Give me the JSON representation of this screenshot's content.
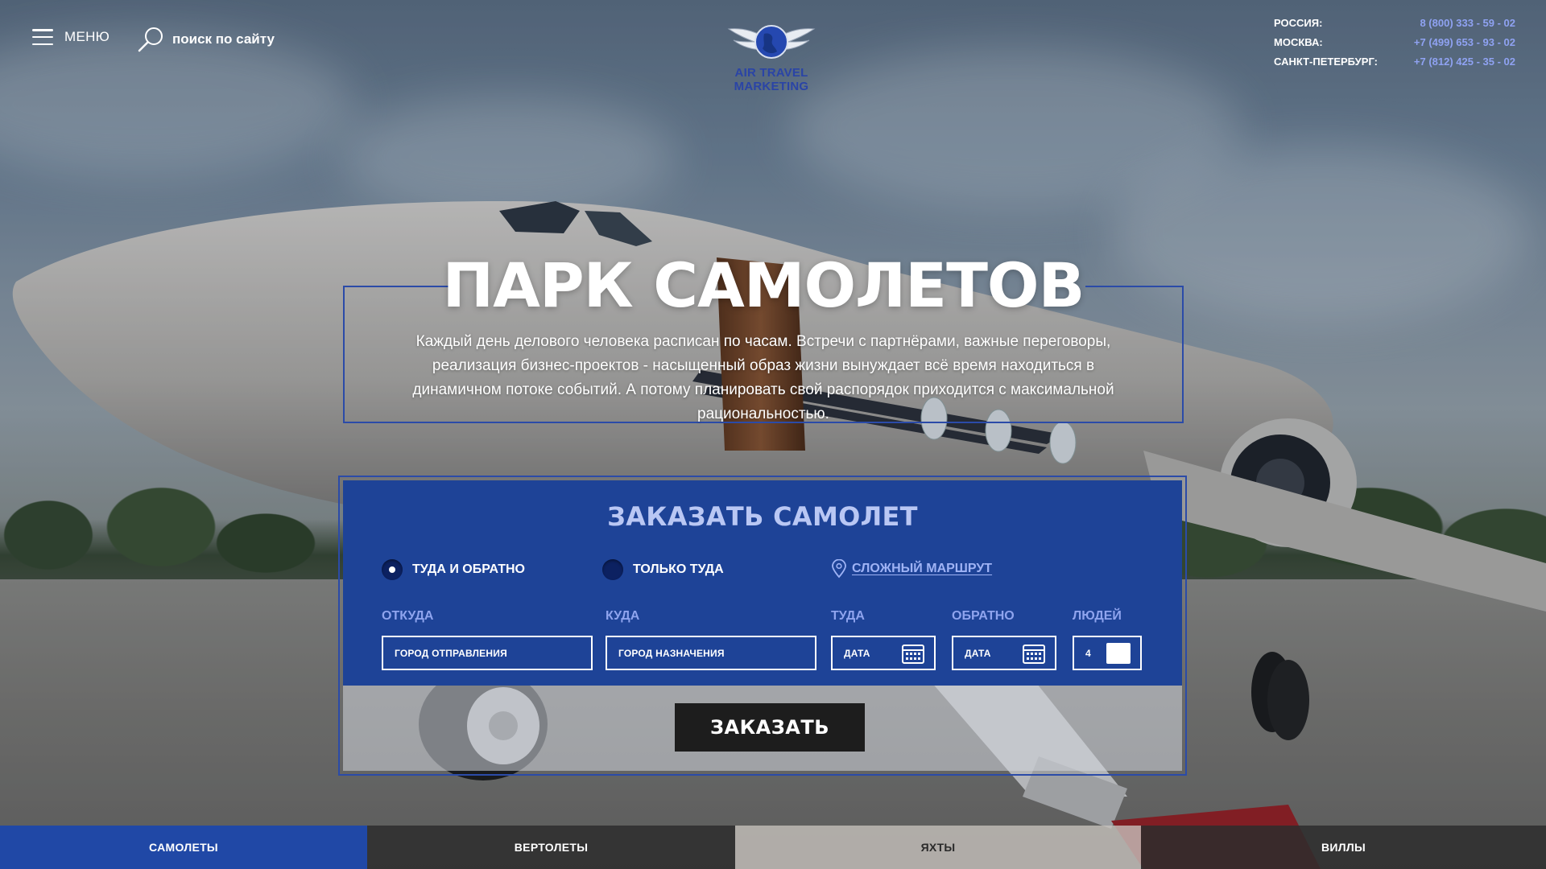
{
  "header": {
    "menu_label": "МЕНЮ",
    "search_label": "поиск по сайту",
    "logo_text": "AIR TRAVEL MARKETING",
    "phones": [
      {
        "city": "РОССИЯ:",
        "number": "8 (800) 333 - 59 - 02"
      },
      {
        "city": "МОСКВА:",
        "number": "+7 (499) 653 - 93 - 02"
      },
      {
        "city": "САНКТ-ПЕТЕРБУРГ:",
        "number": "+7 (812) 425 - 35 - 02"
      }
    ]
  },
  "hero": {
    "title": "ПАРК САМОЛЕТОВ",
    "text": "Каждый день делового человека расписан по часам. Встречи с партнёрами, важные переговоры, реализация бизнес-проектов - насыщенный образ жизни вынуждает всё время находиться в динамичном потоке событий. А потому планировать свой распорядок приходится с максимальной рациональностью."
  },
  "booking": {
    "title": "ЗАКАЗАТЬ САМОЛЕТ",
    "trip_types": [
      {
        "label": "ТУДА И ОБРАТНО",
        "selected": true
      },
      {
        "label": "ТОЛЬКО ТУДА",
        "selected": false
      }
    ],
    "complex_route_label": "СЛОЖНЫЙ МАРШРУТ",
    "fields": {
      "from": {
        "label": "ОТКУДА",
        "placeholder": "ГОРОД ОТПРАВЛЕНИЯ"
      },
      "to": {
        "label": "КУДА",
        "placeholder": "ГОРОД НАЗНАЧЕНИЯ"
      },
      "depart": {
        "label": "ТУДА",
        "placeholder": "ДАТА"
      },
      "return": {
        "label": "ОБРАТНО",
        "placeholder": "ДАТА"
      },
      "people": {
        "label": "ЛЮДЕЙ",
        "value": "4"
      }
    },
    "submit_label": "ЗАКАЗАТЬ"
  },
  "tabs": [
    {
      "label": "САМОЛЕТЫ",
      "active": true
    },
    {
      "label": "ВЕРТОЛЕТЫ",
      "active": false
    },
    {
      "label": "ЯХТЫ",
      "active": false
    },
    {
      "label": "ВИЛЛЫ",
      "active": false
    }
  ],
  "colors": {
    "accent_blue": "#1e4397",
    "tab_active": "#2048a6",
    "phone_number": "#8fa2f2",
    "button_dark": "#1d1d1d"
  },
  "icons": [
    "menu-icon",
    "search-icon",
    "logo-globe-wings",
    "location-pin-icon",
    "calendar-icon"
  ]
}
